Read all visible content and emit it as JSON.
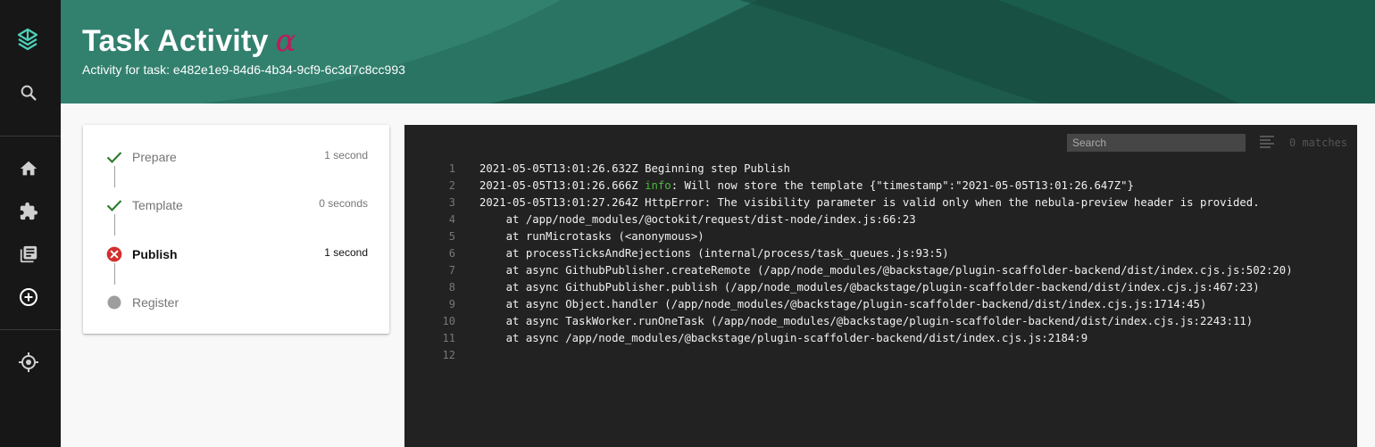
{
  "header": {
    "title": "Task Activity",
    "alpha": "α",
    "subtitle": "Activity for task: e482e1e9-84d6-4b34-9cf9-6c3d7c8cc993"
  },
  "sidebar": {
    "icons": [
      "logo-icon",
      "search-icon",
      "home-icon",
      "puzzle-icon",
      "library-icon",
      "add-circle-icon",
      "target-icon"
    ]
  },
  "steps": [
    {
      "label": "Prepare",
      "duration": "1 second",
      "status": "done"
    },
    {
      "label": "Template",
      "duration": "0 seconds",
      "status": "done"
    },
    {
      "label": "Publish",
      "duration": "1 second",
      "status": "error"
    },
    {
      "label": "Register",
      "duration": "",
      "status": "pending"
    }
  ],
  "log": {
    "search_placeholder": "Search",
    "matches": "0 matches",
    "lines": [
      {
        "num": "1",
        "pre": "2021-05-05T13:01:26.632Z Beginning step Publish",
        "level": "",
        "post": ""
      },
      {
        "num": "2",
        "pre": "2021-05-05T13:01:26.666Z ",
        "level": "info",
        "post": ": Will now store the template {\"timestamp\":\"2021-05-05T13:01:26.647Z\"}"
      },
      {
        "num": "3",
        "pre": "2021-05-05T13:01:27.264Z HttpError: The visibility parameter is valid only when the nebula-preview header is provided.",
        "level": "",
        "post": ""
      },
      {
        "num": "4",
        "pre": "    at /app/node_modules/@octokit/request/dist-node/index.js:66:23",
        "level": "",
        "post": ""
      },
      {
        "num": "5",
        "pre": "    at runMicrotasks (<anonymous>)",
        "level": "",
        "post": ""
      },
      {
        "num": "6",
        "pre": "    at processTicksAndRejections (internal/process/task_queues.js:93:5)",
        "level": "",
        "post": ""
      },
      {
        "num": "7",
        "pre": "    at async GithubPublisher.createRemote (/app/node_modules/@backstage/plugin-scaffolder-backend/dist/index.cjs.js:502:20)",
        "level": "",
        "post": ""
      },
      {
        "num": "8",
        "pre": "    at async GithubPublisher.publish (/app/node_modules/@backstage/plugin-scaffolder-backend/dist/index.cjs.js:467:23)",
        "level": "",
        "post": ""
      },
      {
        "num": "9",
        "pre": "    at async Object.handler (/app/node_modules/@backstage/plugin-scaffolder-backend/dist/index.cjs.js:1714:45)",
        "level": "",
        "post": ""
      },
      {
        "num": "10",
        "pre": "    at async TaskWorker.runOneTask (/app/node_modules/@backstage/plugin-scaffolder-backend/dist/index.cjs.js:2243:11)",
        "level": "",
        "post": ""
      },
      {
        "num": "11",
        "pre": "    at async /app/node_modules/@backstage/plugin-scaffolder-backend/dist/index.cjs.js:2184:9",
        "level": "",
        "post": ""
      },
      {
        "num": "12",
        "pre": "",
        "level": "",
        "post": ""
      }
    ]
  },
  "colors": {
    "header_bg": "#1d5c4d",
    "alpha": "#c2185b",
    "success": "#2e7d32",
    "error": "#d32f2f",
    "pending": "#9e9e9e",
    "log_bg": "#222222",
    "info": "#4cba3b"
  }
}
